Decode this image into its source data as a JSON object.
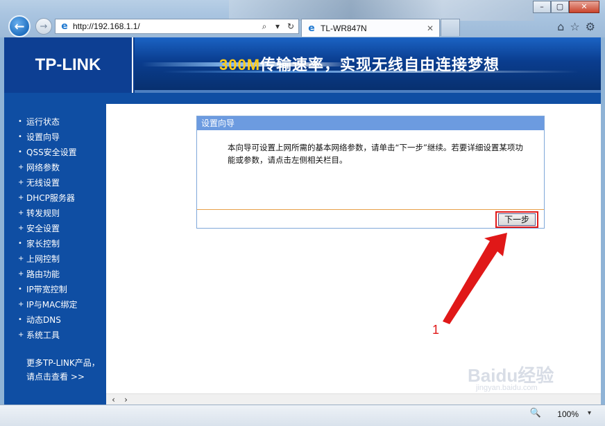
{
  "browser": {
    "address": "http://192.168.1.1/",
    "tab_title": "TL-WR847N",
    "zoom": "100%"
  },
  "banner": {
    "logo": "TP-LINK",
    "slogan_highlight": "300M",
    "slogan_rest": "传输速率，实现无线自由连接梦想"
  },
  "sidebar": {
    "items": [
      {
        "marker": "•",
        "label": "运行状态"
      },
      {
        "marker": "•",
        "label": "设置向导"
      },
      {
        "marker": "•",
        "label": "QSS安全设置"
      },
      {
        "marker": "+",
        "label": "网络参数"
      },
      {
        "marker": "+",
        "label": "无线设置"
      },
      {
        "marker": "+",
        "label": "DHCP服务器"
      },
      {
        "marker": "+",
        "label": "转发规则"
      },
      {
        "marker": "+",
        "label": "安全设置"
      },
      {
        "marker": "•",
        "label": "家长控制"
      },
      {
        "marker": "+",
        "label": "上网控制"
      },
      {
        "marker": "+",
        "label": "路由功能"
      },
      {
        "marker": "•",
        "label": "IP带宽控制"
      },
      {
        "marker": "+",
        "label": "IP与MAC绑定"
      },
      {
        "marker": "•",
        "label": "动态DNS"
      },
      {
        "marker": "+",
        "label": "系统工具"
      }
    ],
    "more_line1": "更多TP-LINK产品，",
    "more_line2": "请点击查看 >>"
  },
  "wizard": {
    "title": "设置向导",
    "text": "本向导可设置上网所需的基本网络参数，请单击“下一步”继续。若要详细设置某项功能或参数，请点击左侧相关栏目。",
    "next_label": "下一步"
  },
  "annotation": {
    "number": "1",
    "color": "#e01818"
  },
  "watermark": {
    "main": "Baidu经验",
    "sub": "jingyan.baidu.com"
  }
}
